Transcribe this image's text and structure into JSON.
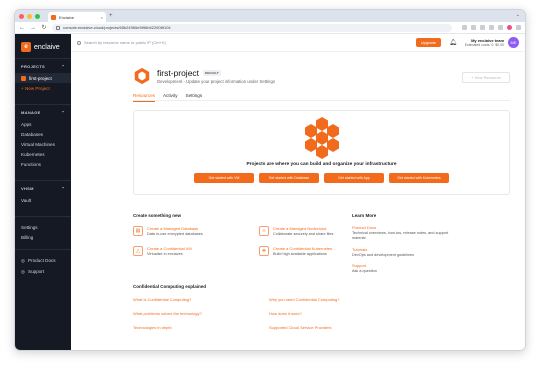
{
  "browser": {
    "tab_title": "Enclaive",
    "tab_close": "×",
    "new_tab": "+",
    "url": "console.enclaive.cloud/projects/65b24965e5f96b622908f104",
    "back": "←",
    "forward": "→",
    "reload": "↻",
    "chevron": "⌄",
    "traffic_colors": [
      "#ff5f57",
      "#febc2e",
      "#28c840"
    ]
  },
  "brand": {
    "name": "enclaive",
    "accent": "#f26b1d"
  },
  "sidebar": {
    "projects_header": "PROJECTS",
    "projects": [
      {
        "label": "first-project",
        "active": true
      },
      {
        "label": "+ New Project",
        "active": false
      }
    ],
    "manage_header": "MANAGE",
    "manage_items": [
      "Apps",
      "Databases",
      "Virtual Machines",
      "Kubernetes",
      "Functions"
    ],
    "vhsm_header": "VHSM",
    "vhsm_items": [
      "Vault"
    ],
    "account_items": [
      "Settings",
      "Billing"
    ],
    "footer_items": [
      "Product Docs",
      "Support"
    ],
    "collapse_chevron": "⌃"
  },
  "topbar": {
    "search_placeholder": "Search by resource name or public IP (Ctrl+K)",
    "upgrade_label": "Upgrade",
    "team_name": "My enclaive team",
    "team_costs": "Estimated costs: 0. $0.00",
    "avatar_initials": "ME"
  },
  "project": {
    "title": "first-project",
    "badge": "DEFAULT",
    "subtitle": "Development - Update your project information under Settings",
    "new_resource_label": "+ New Resource"
  },
  "tabs": [
    "Resources",
    "Activity",
    "Settings"
  ],
  "empty_state": {
    "headline": "Projects are where you can build and organize your infrastructure",
    "buttons": [
      "Get started with VM",
      "Get started with Database",
      "Get started with App",
      "Get started with Kubernetes"
    ]
  },
  "create": {
    "title": "Create something new",
    "items": [
      {
        "title": "Create a Managed Database",
        "desc": "Data in-use encrypted databases",
        "icon": "database-icon",
        "glyph": "▤"
      },
      {
        "title": "Create a Managed Nodecloud",
        "desc": "Collaborate securely and share files",
        "icon": "code-icon",
        "glyph": "‹›"
      },
      {
        "title": "Create a Confidential VM",
        "desc": "Virtualize in enclaves",
        "icon": "vm-icon",
        "glyph": "△"
      },
      {
        "title": "Create a Confidential Kubernetes",
        "desc": "Build high available applications",
        "icon": "kubernetes-icon",
        "glyph": "⎈"
      }
    ]
  },
  "learn": {
    "title": "Learn More",
    "items": [
      {
        "title": "Product Docs",
        "desc": "Technical overviews, how-tos, release notes, and support material"
      },
      {
        "title": "Tutorials",
        "desc": "DevOps and development guidelines"
      },
      {
        "title": "Support",
        "desc": "Ask a question"
      }
    ]
  },
  "confidential": {
    "title": "Confidential Computing explained",
    "links": [
      "What is Confidential Computing?",
      "Why you need Confidential Computing?",
      "What problems solves the technology?",
      "How does it work?",
      "Technologies in depth",
      "Supported Cloud Service Providers"
    ]
  }
}
